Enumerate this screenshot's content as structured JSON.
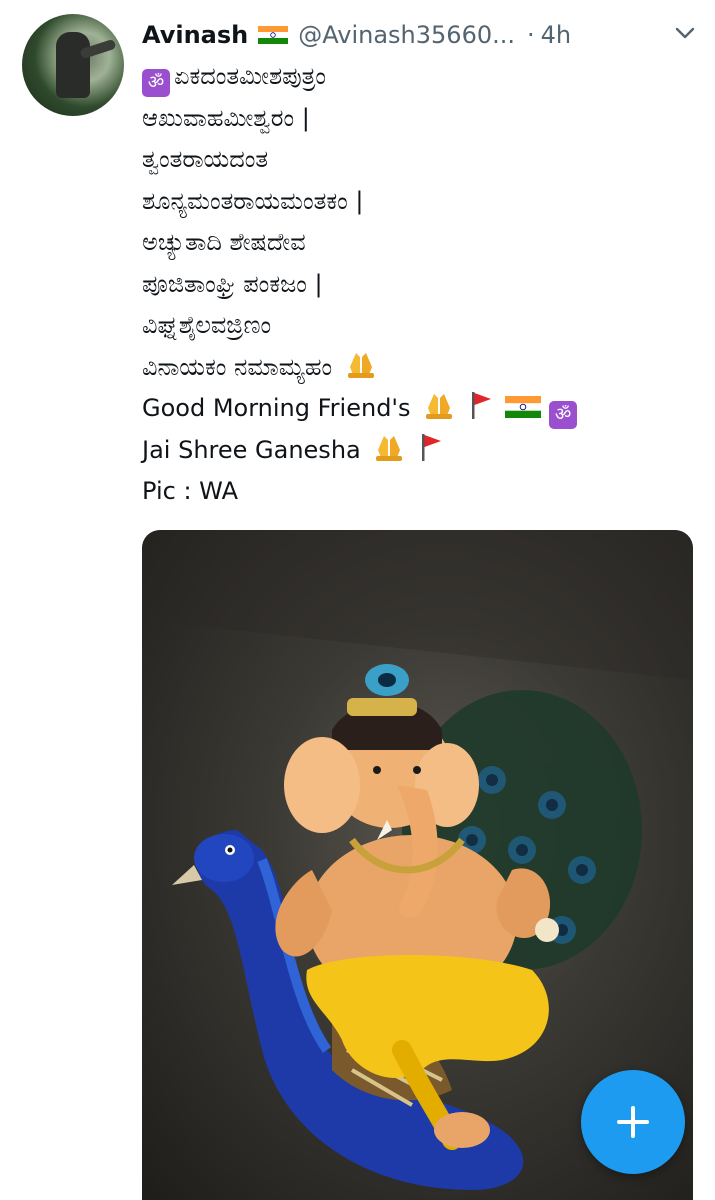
{
  "tweet": {
    "author_name": "Avinash",
    "author_flag_icon": "india-flag-icon",
    "handle": "@Avinash35660...",
    "separator": "·",
    "time": "4h",
    "lines": [
      "ಏಕದಂತಮೀಶಪುತ್ರಂ",
      "ಆಖುವಾಹಮೀಶ್ವರಂ |",
      "ತ್ವಂತರಾಯದಂತ",
      "ಶೂನ್ಯಮಂತರಾಯಮಂತಕಂ |",
      "ಅಚ್ಯುತಾದಿ ಶೇಷದೇವ",
      "ಪೂಜಿತಾಂಘ್ರಿ ಪಂಕಜಂ |",
      "ವಿಘ್ನಶೈಲವಜ್ರಿಣಂ",
      "ವಿನಾಯಕಂ ನಮಾಮ್ಯಹಂ",
      "Good Morning Friend's",
      "Jai Shree Ganesha",
      "Pic : WA"
    ],
    "om_symbol": "ॐ",
    "media_alt": "Ganesha idol seated on a peacock"
  },
  "colors": {
    "link_blue": "#1d9bf0",
    "secondary_text": "#536471",
    "om_purple": "#9a4fcf"
  },
  "fab": {
    "icon": "plus-icon"
  }
}
